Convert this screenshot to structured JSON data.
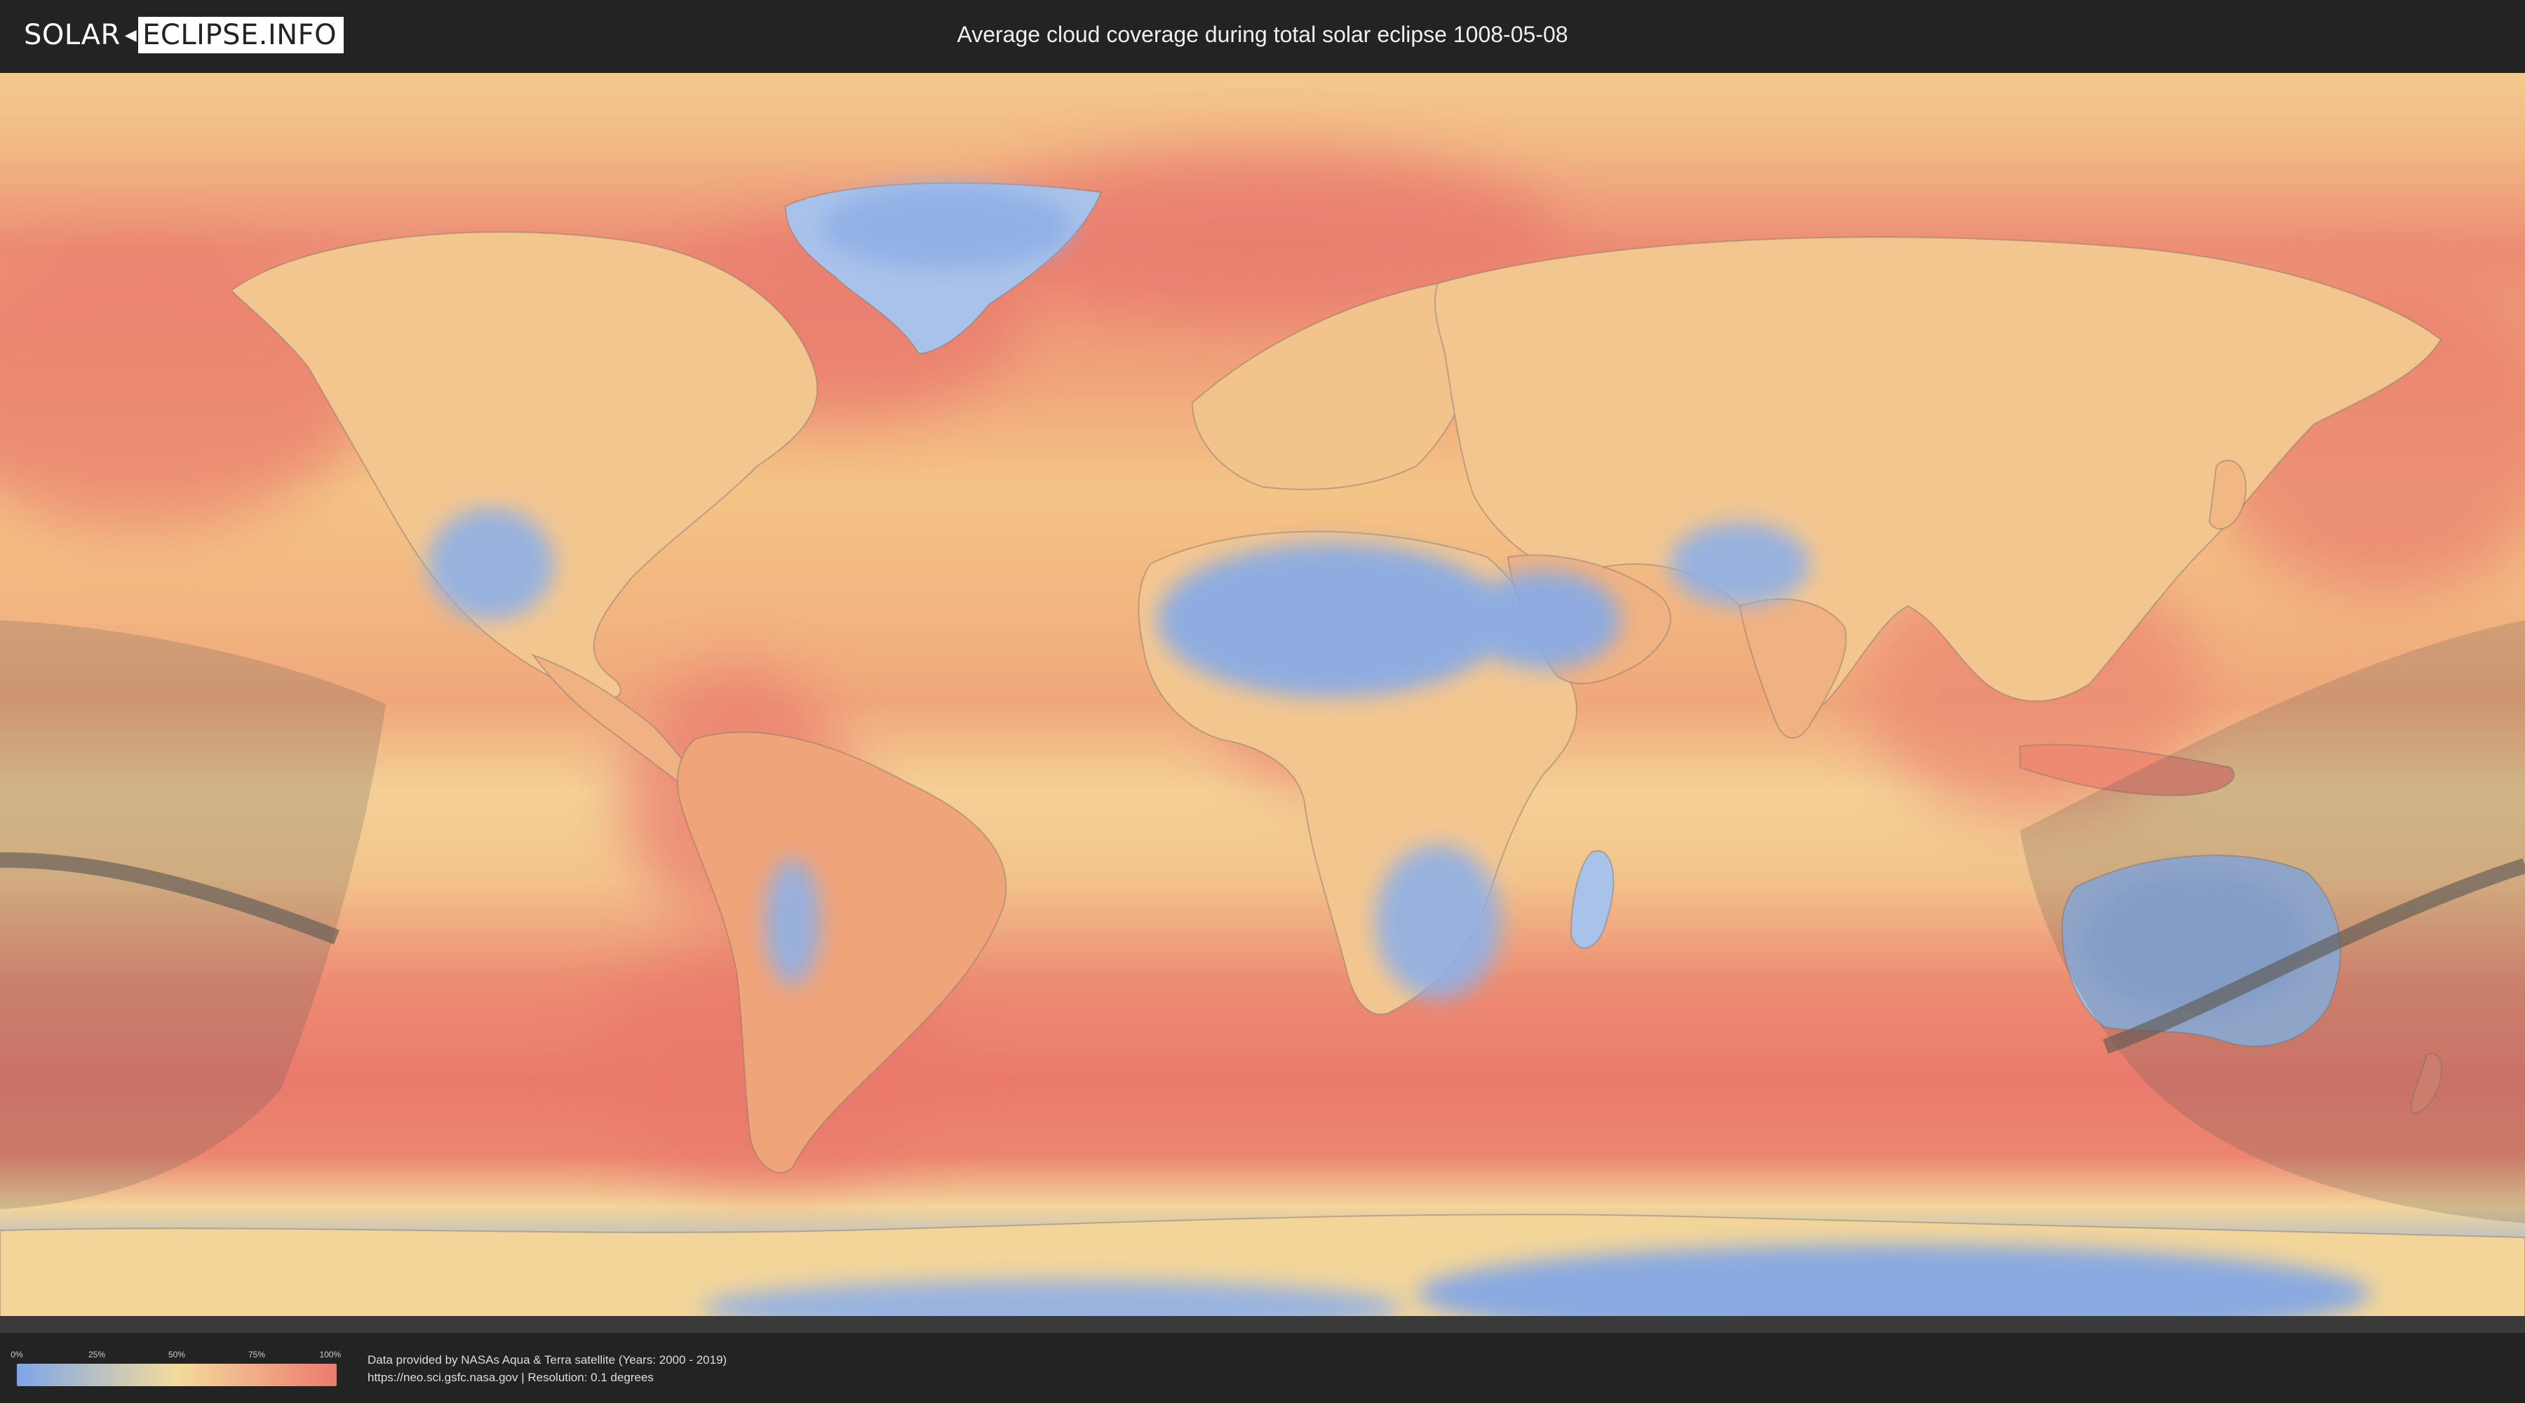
{
  "header": {
    "logo_left": "SOLAR",
    "logo_right": "ECLIPSE.INFO",
    "title": "Average cloud coverage during total solar eclipse 1008-05-08"
  },
  "legend": {
    "ticks": [
      "0%",
      "25%",
      "50%",
      "75%",
      "100%"
    ],
    "values": [
      0,
      25,
      50,
      75,
      100
    ],
    "colors": [
      "#7ea5e8",
      "#f3dc9c",
      "#ec7a6e"
    ]
  },
  "credits": {
    "line1": "Data provided by NASAs Aqua & Terra satellite (Years: 2000 - 2019)",
    "line2": "https://neo.sci.gsfc.nasa.gov | Resolution: 0.1 degrees"
  },
  "map": {
    "projection": "equirectangular",
    "colors": {
      "clear": "#7ea5e8",
      "medium": "#f3dc9c",
      "overcast": "#ec7a6e",
      "shadow": "#555555"
    }
  }
}
